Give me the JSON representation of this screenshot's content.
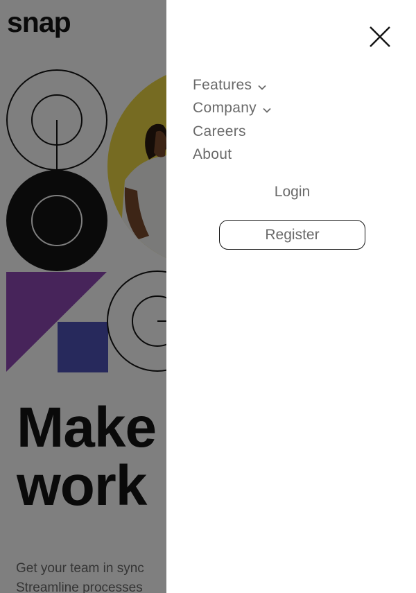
{
  "header": {
    "logo": "snap"
  },
  "hero": {
    "title_line1": "Make",
    "title_line2": "work",
    "subtitle_line1": "Get your team in sync",
    "subtitle_line2": "Streamline processes"
  },
  "menu": {
    "items": [
      {
        "label": "Features",
        "has_dropdown": true
      },
      {
        "label": "Company",
        "has_dropdown": true
      },
      {
        "label": "Careers",
        "has_dropdown": false
      },
      {
        "label": "About",
        "has_dropdown": false
      }
    ],
    "login_label": "Login",
    "register_label": "Register",
    "close_icon": "close-icon"
  },
  "colors": {
    "text_dark": "#141414",
    "text_gray": "#696969",
    "overlay": "rgba(0,0,0,0.5)",
    "purple": "#8e48b4",
    "blue": "#4e52b8",
    "yellow": "#ecd744"
  }
}
